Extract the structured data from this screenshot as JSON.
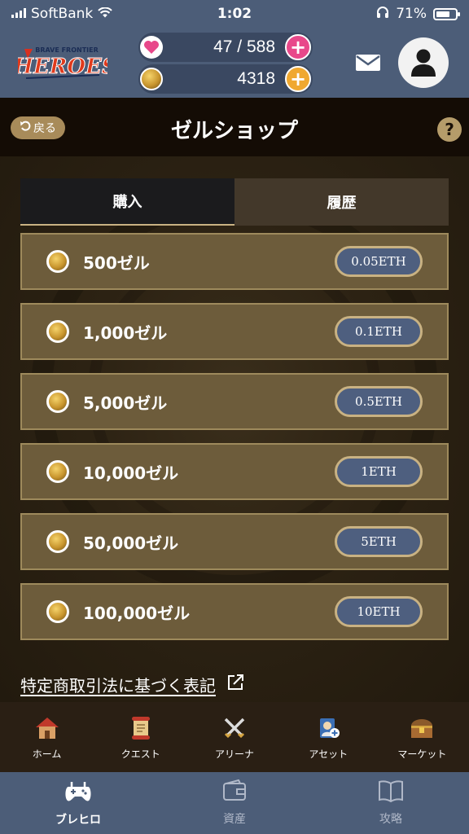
{
  "status_bar": {
    "carrier": "SoftBank",
    "time": "1:02",
    "battery": "71%"
  },
  "header": {
    "logo_text": "HEROES",
    "logo_subtext": "BRAVE FRONTIER",
    "stamina": "47 / 588",
    "zel": "4318"
  },
  "title_bar": {
    "back_label": "戻る",
    "title": "ゼルショップ",
    "help_label": "?"
  },
  "tabs": [
    {
      "label": "購入",
      "active": true
    },
    {
      "label": "履歴",
      "active": false
    }
  ],
  "products": [
    {
      "label": "500ゼル",
      "price": "0.05ETH"
    },
    {
      "label": "1,000ゼル",
      "price": "0.1ETH"
    },
    {
      "label": "5,000ゼル",
      "price": "0.5ETH"
    },
    {
      "label": "10,000ゼル",
      "price": "1ETH"
    },
    {
      "label": "50,000ゼル",
      "price": "5ETH"
    },
    {
      "label": "100,000ゼル",
      "price": "10ETH"
    }
  ],
  "law_link": "特定商取引法に基づく表記",
  "game_nav": [
    {
      "label": "ホーム",
      "icon": "house-icon"
    },
    {
      "label": "クエスト",
      "icon": "scroll-icon"
    },
    {
      "label": "アリーナ",
      "icon": "crossed-swords-icon"
    },
    {
      "label": "アセット",
      "icon": "character-card-icon"
    },
    {
      "label": "マーケット",
      "icon": "treasure-chest-icon"
    }
  ],
  "tab_bar": [
    {
      "label": "ブレヒロ",
      "icon": "gamepad-icon",
      "active": true
    },
    {
      "label": "資産",
      "icon": "wallet-icon",
      "active": false
    },
    {
      "label": "攻略",
      "icon": "book-icon",
      "active": false
    }
  ],
  "colors": {
    "header_bg": "#4c5d78",
    "item_bg": "#6d5c3b",
    "item_border": "#9e8a5c",
    "price_btn_bg": "#4e5f7f",
    "accent_gold": "#c9b283",
    "heart_pink": "#e8488a",
    "plus_orange": "#f0a830"
  }
}
